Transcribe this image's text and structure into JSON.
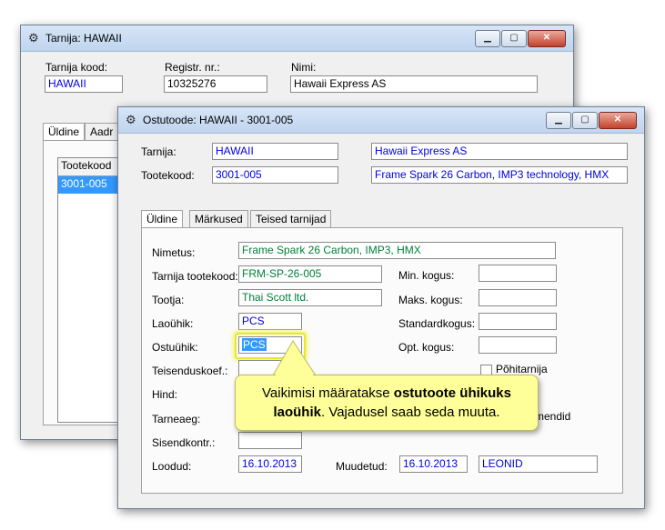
{
  "back_window": {
    "title": "Tarnija: HAWAII",
    "supplier_code_label": "Tarnija kood:",
    "supplier_code": "HAWAII",
    "reg_label": "Registr. nr.:",
    "reg_value": "10325276",
    "name_label": "Nimi:",
    "name_value": "Hawaii Express AS",
    "tabs": [
      "Üldine",
      "Aadr"
    ],
    "list_header": "Tootekood",
    "list_items": [
      "3001-005"
    ]
  },
  "front_window": {
    "title": "Ostutoode: HAWAII - 3001-005",
    "supplier_label": "Tarnija:",
    "supplier_code": "HAWAII",
    "supplier_name": "Hawaii Express AS",
    "product_code_label": "Tootekood:",
    "product_code": "3001-005",
    "product_desc": "Frame Spark 26 Carbon, IMP3 technology, HMX",
    "tabs": [
      "Üldine",
      "Märkused",
      "Teised tarnijad"
    ],
    "form": {
      "name_label": "Nimetus:",
      "name_value": "Frame Spark 26 Carbon, IMP3, HMX",
      "supplier_product_code_label": "Tarnija tootekood:",
      "supplier_product_code": "FRM-SP-26-005",
      "manufacturer_label": "Tootja:",
      "manufacturer_value": "Thai Scott ltd.",
      "stock_unit_label": "Laoühik:",
      "stock_unit_value": "PCS",
      "purchase_unit_label": "Ostuühik:",
      "purchase_unit_value": "PCS",
      "conversion_label": "Teisenduskoef.:",
      "price_label": "Hind:",
      "lead_time_label": "Tarneaeg:",
      "input_control_label": "Sisendkontr.:",
      "created_label": "Loodud:",
      "created_value": "16.10.2013",
      "min_qty_label": "Min. kogus:",
      "max_qty_label": "Maks. kogus:",
      "standard_qty_label": "Standardkogus:",
      "opt_qty_label": "Opt. kogus:",
      "main_supplier_label": "Põhitarnija",
      "recommend_partial": "mendid",
      "modified_label": "Muudetud:",
      "modified_value": "16.10.2013",
      "modified_by": "LEONID"
    }
  },
  "callout": {
    "text_1": "Vaikimisi määratakse ",
    "bold_1": "ostutoote ühikuks",
    "bold_2": "laoühik",
    "text_2": ". Vajadusel saab seda muuta."
  }
}
